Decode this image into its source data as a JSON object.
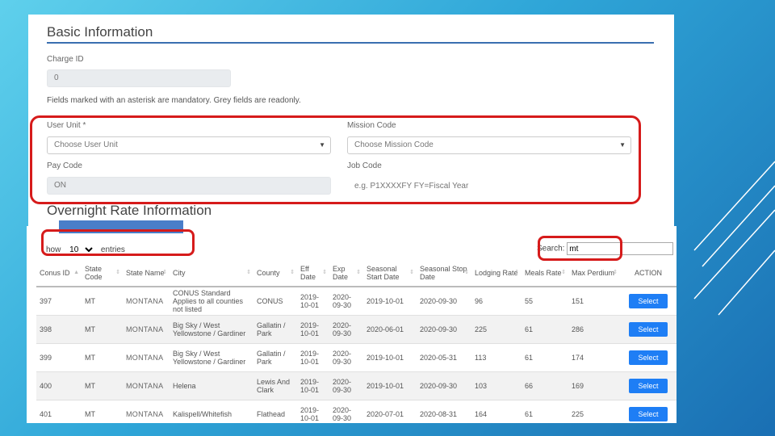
{
  "basic": {
    "title": "Basic Information",
    "charge_id_label": "Charge ID",
    "charge_id_value": "0",
    "note": "Fields marked with an asterisk are mandatory. Grey fields are readonly.",
    "user_unit_label": "User Unit *",
    "user_unit_value": "Choose User Unit",
    "mission_code_label": "Mission Code",
    "mission_code_value": "Choose Mission Code",
    "pay_code_label": "Pay Code",
    "pay_code_value": "ON",
    "job_code_label": "Job Code",
    "job_code_placeholder": "e.g. P1XXXXFY FY=Fiscal Year"
  },
  "overnight": {
    "title": "Overnight Rate Information",
    "show_prefix": "how",
    "length_value": "10",
    "show_suffix": "entries",
    "search_label": "Search:",
    "search_value": "mt",
    "columns": [
      "Conus ID",
      "State Code",
      "State Name",
      "City",
      "County",
      "Eff Date",
      "Exp Date",
      "Seasonal Start Date",
      "Seasonal Stop Date",
      "Lodging Rate",
      "Meals Rate",
      "Max Perdium",
      "ACTION"
    ],
    "rows": [
      [
        "397",
        "MT",
        "MONTANA",
        "CONUS Standard Applies to all counties not listed",
        "CONUS",
        "2019-10-01",
        "2020-09-30",
        "2019-10-01",
        "2020-09-30",
        "96",
        "55",
        "151",
        "Select"
      ],
      [
        "398",
        "MT",
        "MONTANA",
        "Big Sky / West Yellowstone / Gardiner",
        "Gallatin / Park",
        "2019-10-01",
        "2020-09-30",
        "2020-06-01",
        "2020-09-30",
        "225",
        "61",
        "286",
        "Select"
      ],
      [
        "399",
        "MT",
        "MONTANA",
        "Big Sky / West Yellowstone / Gardiner",
        "Gallatin / Park",
        "2019-10-01",
        "2020-09-30",
        "2019-10-01",
        "2020-05-31",
        "113",
        "61",
        "174",
        "Select"
      ],
      [
        "400",
        "MT",
        "MONTANA",
        "Helena",
        "Lewis And Clark",
        "2019-10-01",
        "2020-09-30",
        "2019-10-01",
        "2020-09-30",
        "103",
        "66",
        "169",
        "Select"
      ],
      [
        "401",
        "MT",
        "MONTANA",
        "Kalispell/Whitefish",
        "Flathead",
        "2019-10-01",
        "2020-09-30",
        "2020-07-01",
        "2020-08-31",
        "164",
        "61",
        "225",
        "Select"
      ]
    ]
  },
  "colors": {
    "accent": "#1e7ef5",
    "highlight": "#d61b1b",
    "rule": "#3a6fb0"
  }
}
